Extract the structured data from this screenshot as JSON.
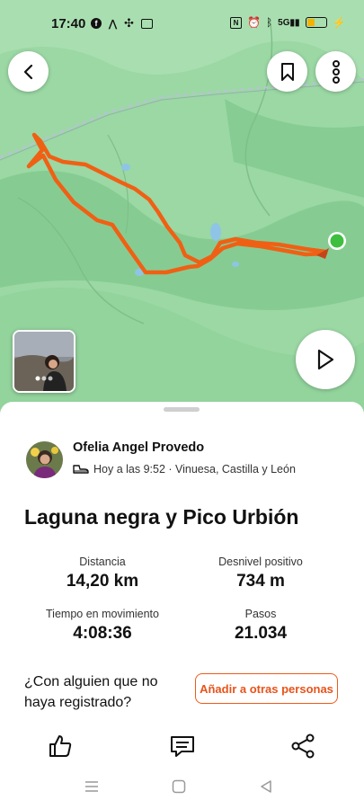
{
  "status_bar": {
    "time": "17:40",
    "network": "5G"
  },
  "map": {
    "start_color": "#3fbf3f",
    "route_color": "#f06014"
  },
  "activity": {
    "user_name": "Ofelia Angel Provedo",
    "meta": "Hoy a las 9:52 · Vinuesa, Castilla y León",
    "title": "Laguna negra y Pico Urbión"
  },
  "stats": [
    {
      "label": "Distancia",
      "value": "14,20 km"
    },
    {
      "label": "Desnivel positivo",
      "value": "734 m"
    },
    {
      "label": "Tiempo en movimiento",
      "value": "4:08:36"
    },
    {
      "label": "Pasos",
      "value": "21.034"
    }
  ],
  "companions": {
    "question": "¿Con alguien que no haya registrado?",
    "button_label": "Añadir a otras personas"
  },
  "colors": {
    "accent": "#f05a1a",
    "map_green": "#8fd49a"
  }
}
